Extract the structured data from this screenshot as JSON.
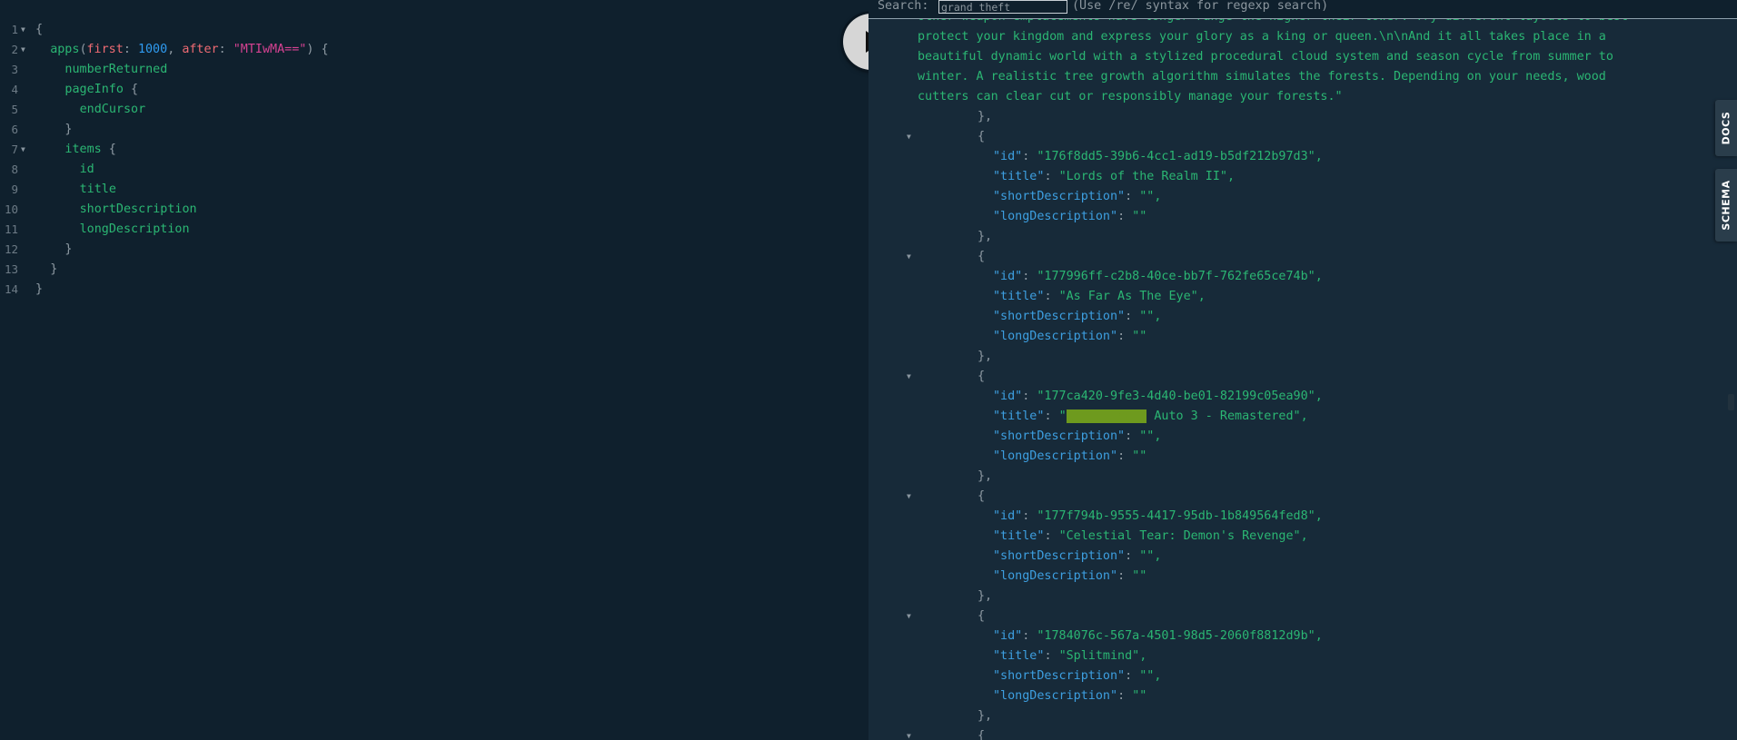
{
  "query_editor": {
    "lines": [
      {
        "num": "1",
        "fold": true,
        "indent": 0,
        "tokens": [
          {
            "t": "{",
            "c": "punc"
          }
        ]
      },
      {
        "num": "2",
        "fold": true,
        "indent": 1,
        "tokens": [
          {
            "t": "apps",
            "c": "field"
          },
          {
            "t": "(",
            "c": "punc"
          },
          {
            "t": "first",
            "c": "arg"
          },
          {
            "t": ": ",
            "c": "punc"
          },
          {
            "t": "1000",
            "c": "num"
          },
          {
            "t": ", ",
            "c": "punc"
          },
          {
            "t": "after",
            "c": "arg"
          },
          {
            "t": ": ",
            "c": "punc"
          },
          {
            "t": "\"MTIwMA==\"",
            "c": "str"
          },
          {
            "t": ") {",
            "c": "punc"
          }
        ]
      },
      {
        "num": "3",
        "fold": false,
        "indent": 2,
        "tokens": [
          {
            "t": "numberReturned",
            "c": "field"
          }
        ]
      },
      {
        "num": "4",
        "fold": false,
        "indent": 2,
        "tokens": [
          {
            "t": "pageInfo",
            "c": "field"
          },
          {
            "t": " {",
            "c": "punc"
          }
        ]
      },
      {
        "num": "5",
        "fold": false,
        "indent": 3,
        "tokens": [
          {
            "t": "endCursor",
            "c": "field"
          }
        ]
      },
      {
        "num": "6",
        "fold": false,
        "indent": 2,
        "tokens": [
          {
            "t": "}",
            "c": "punc"
          }
        ]
      },
      {
        "num": "7",
        "fold": true,
        "indent": 2,
        "tokens": [
          {
            "t": "items",
            "c": "field"
          },
          {
            "t": " {",
            "c": "punc"
          }
        ]
      },
      {
        "num": "8",
        "fold": false,
        "indent": 3,
        "tokens": [
          {
            "t": "id",
            "c": "field"
          }
        ]
      },
      {
        "num": "9",
        "fold": false,
        "indent": 3,
        "tokens": [
          {
            "t": "title",
            "c": "field"
          }
        ]
      },
      {
        "num": "10",
        "fold": false,
        "indent": 3,
        "tokens": [
          {
            "t": "shortDescription",
            "c": "field"
          }
        ]
      },
      {
        "num": "11",
        "fold": false,
        "indent": 3,
        "tokens": [
          {
            "t": "longDescription",
            "c": "field"
          }
        ]
      },
      {
        "num": "12",
        "fold": false,
        "indent": 2,
        "tokens": [
          {
            "t": "}",
            "c": "punc"
          }
        ]
      },
      {
        "num": "13",
        "fold": false,
        "indent": 1,
        "tokens": [
          {
            "t": "}",
            "c": "punc"
          }
        ]
      },
      {
        "num": "14",
        "fold": false,
        "indent": 0,
        "tokens": [
          {
            "t": "}",
            "c": "punc"
          }
        ]
      }
    ]
  },
  "execute_button": {
    "icon": "play-icon"
  },
  "search": {
    "label": "Search:",
    "value": "grand theft",
    "hint": "(Use /re/ syntax for regexp search)"
  },
  "results": {
    "description_tail": [
      "other weapon emplacements have longer range the higher their tower. Try different layouts to best",
      "protect your kingdom and express your glory as a king or queen.\\n\\nAnd it all takes place in a",
      "beautiful dynamic world with a stylized procedural cloud system and season cycle from summer to",
      "winter. A realistic tree growth algorithm simulates the forests. Depending on your needs, wood",
      "cutters can clear cut or responsibly manage your forests.\""
    ],
    "open_brace": "{",
    "close_brace": "},",
    "keys": {
      "id": "\"id\"",
      "title": "\"title\"",
      "shortDescription": "\"shortDescription\"",
      "longDescription": "\"longDescription\""
    },
    "items": [
      {
        "id": "\"176f8dd5-39b6-4cc1-ad19-b5df212b97d3\",",
        "title_pre": "\"Lords of the Realm II\",",
        "title_match": "",
        "title_post": "",
        "short": "\"\",",
        "long": "\"\""
      },
      {
        "id": "\"177996ff-c2b8-40ce-bb7f-762fe65ce74b\",",
        "title_pre": "\"As Far As The Eye\",",
        "title_match": "",
        "title_post": "",
        "short": "\"\",",
        "long": "\"\""
      },
      {
        "id": "\"177ca420-9fe3-4d40-be01-82199c05ea90\",",
        "title_pre": "\"",
        "title_match": "Grand Theft",
        "title_post": " Auto 3 - Remastered\",",
        "short": "\"\",",
        "long": "\"\""
      },
      {
        "id": "\"177f794b-9555-4417-95db-1b849564fed8\",",
        "title_pre": "\"Celestial Tear: Demon's Revenge\",",
        "title_match": "",
        "title_post": "",
        "short": "\"\",",
        "long": "\"\""
      },
      {
        "id": "\"1784076c-567a-4501-98d5-2060f8812d9b\",",
        "title_pre": "\"Splitmind\",",
        "title_match": "",
        "title_post": "",
        "short": "\"\",",
        "long": "\"\""
      }
    ]
  },
  "side_tabs": {
    "docs": "DOCS",
    "schema": "SCHEMA"
  }
}
